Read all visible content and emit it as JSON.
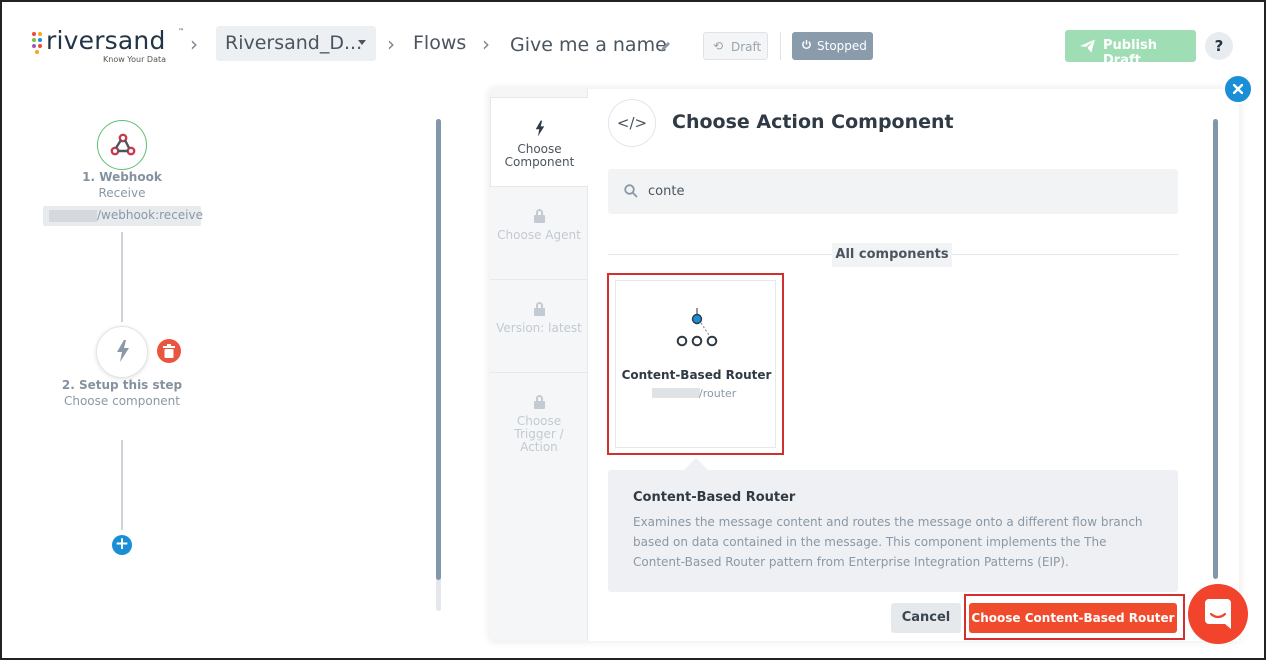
{
  "header": {
    "logo_text": "riversand",
    "logo_tagline": "Know Your Data",
    "breadcrumb": {
      "project": "Riversand_D...",
      "section": "Flows",
      "flow_name": "Give me a name"
    },
    "draft_badge": "Draft",
    "status_badge": "Stopped",
    "publish_button": "Publish Draft",
    "help_button": "?"
  },
  "flow": {
    "steps": [
      {
        "title": "1. Webhook",
        "subtitle": "Receive",
        "path": "/webhook:receive",
        "icon": "webhook-icon"
      },
      {
        "title": "2. Setup this step",
        "subtitle": "Choose component",
        "icon": "lightning-icon"
      }
    ]
  },
  "modal": {
    "title": "Choose Action Component",
    "wizard_steps": [
      {
        "label": "Choose Component",
        "active": true,
        "icon": "lightning-icon"
      },
      {
        "label": "Choose Agent",
        "active": false,
        "icon": "lock-icon"
      },
      {
        "label": "Version: latest",
        "active": false,
        "icon": "lock-icon"
      },
      {
        "label": "Choose Trigger / Action",
        "active": false,
        "icon": "lock-icon"
      }
    ],
    "search": {
      "value": "conte"
    },
    "section_label": "All components",
    "components": [
      {
        "name": "Content-Based Router",
        "path": "/router",
        "icon": "router-tree-icon"
      }
    ],
    "description": {
      "title": "Content-Based Router",
      "text": "Examines the message content and routes the message onto a different flow branch based on data contained in the message. This component implements the The Content-Based Router pattern from Enterprise Integration Patterns (EIP)."
    },
    "cancel_button": "Cancel",
    "choose_button": "Choose Content-Based Router"
  },
  "colors": {
    "accent_blue": "#1a8fd6",
    "primary_red": "#f04b2d",
    "publish_green": "#9fdeb5",
    "status_gray": "#8a9bab",
    "highlight_red": "#d32f2f"
  }
}
